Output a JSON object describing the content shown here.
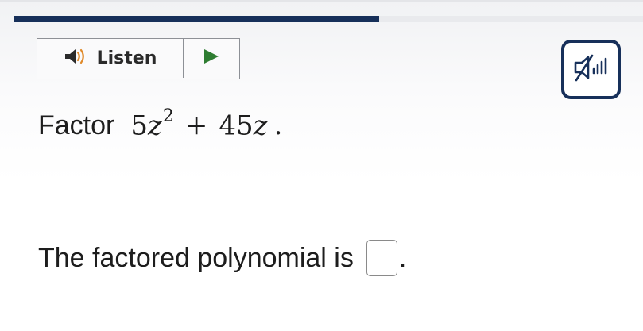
{
  "progress": {
    "fraction": 0.58,
    "fill_color": "#17305a"
  },
  "listen": {
    "label": "Listen",
    "speaker_icon": "speaker-icon",
    "play_icon": "play-icon",
    "play_color": "#2e7d32"
  },
  "audio_toggle": {
    "icon": "mute-icon",
    "border_color": "#17305a"
  },
  "question": {
    "prompt": "Factor",
    "expression": {
      "coef1": "5",
      "var": "z",
      "exponent": "2",
      "operator": "+",
      "coef2": "45",
      "var2": "z",
      "period": "."
    }
  },
  "answer": {
    "label": "The factored polynomial is",
    "value": "",
    "trailing": "."
  }
}
